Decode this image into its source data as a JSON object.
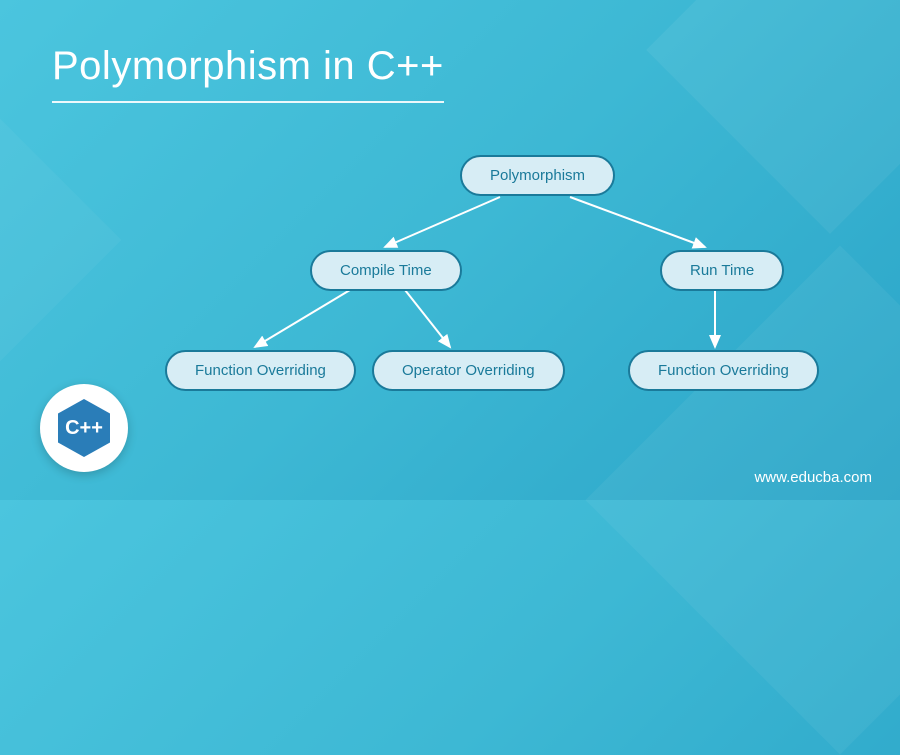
{
  "title": "Polymorphism in C++",
  "nodes": {
    "root": "Polymorphism",
    "compile": "Compile Time",
    "runtime": "Run Time",
    "func_over": "Function Overriding",
    "op_over": "Operator Overriding",
    "rt_func_over": "Function Overriding"
  },
  "logo_text": "C++",
  "website": "www.educba.com"
}
